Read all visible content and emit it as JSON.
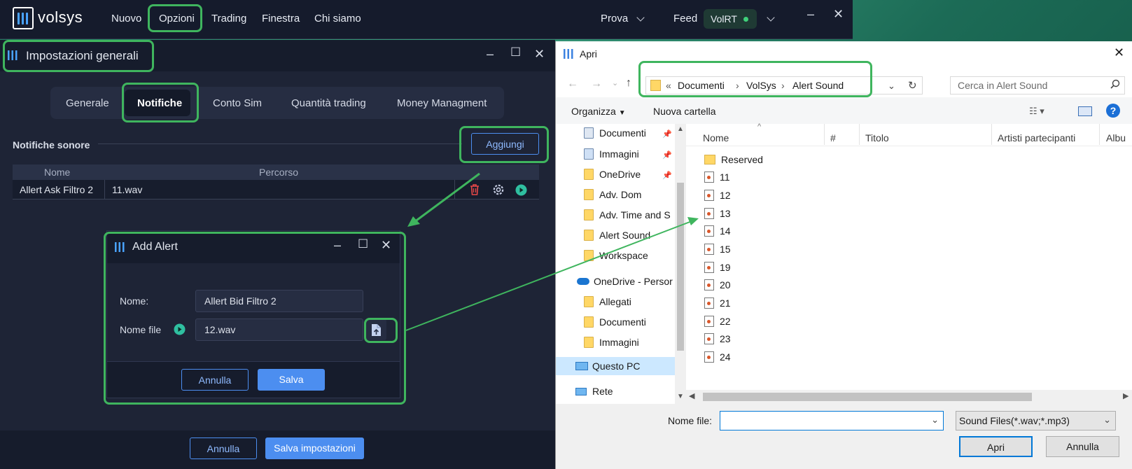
{
  "app": {
    "logo": "volsys",
    "menu": [
      "Nuovo",
      "Opzioni",
      "Trading",
      "Finestra",
      "Chi siamo"
    ],
    "right": {
      "prova": "Prova",
      "feed": "Feed",
      "feed_badge": "VolRT"
    }
  },
  "settings": {
    "title": "Impostazioni generali",
    "tabs": [
      "Generale",
      "Notifiche",
      "Conto Sim",
      "Quantità trading",
      "Money Managment"
    ],
    "active_tab": "Notifiche",
    "section_title": "Notifiche sonore",
    "add_button": "Aggiungi",
    "table": {
      "headers": [
        "Nome",
        "Percorso"
      ],
      "rows": [
        {
          "name": "Allert Ask Filtro 2",
          "path": "11.wav"
        }
      ]
    },
    "footer": {
      "cancel": "Annulla",
      "save": "Salva impostazioni"
    }
  },
  "add_alert": {
    "title": "Add Alert",
    "name_label": "Nome:",
    "name_value": "Allert Bid Filtro 2",
    "file_label": "Nome file",
    "file_value": "12.wav",
    "cancel": "Annulla",
    "save": "Salva"
  },
  "file_dialog": {
    "title": "Apri",
    "breadcrumb_prefix": "«",
    "breadcrumb": [
      "Documenti",
      "VolSys",
      "Alert Sound"
    ],
    "search_placeholder": "Cerca in Alert Sound",
    "toolbar": {
      "organize": "Organizza",
      "new_folder": "Nuova cartella"
    },
    "tree": {
      "quick_access": [
        "Documenti",
        "Immagini",
        "OneDrive",
        "Adv. Dom",
        "Adv. Time and S",
        "Alert Sound",
        "Workspace"
      ],
      "onedrive": "OneDrive - Persor",
      "onedrive_items": [
        "Allegati",
        "Documenti",
        "Immagini"
      ],
      "this_pc": "Questo PC",
      "network": "Rete"
    },
    "columns": [
      "Nome",
      "#",
      "Titolo",
      "Artisti partecipanti",
      "Albu"
    ],
    "folders": [
      "Reserved"
    ],
    "files": [
      "11",
      "12",
      "13",
      "14",
      "15",
      "19",
      "20",
      "21",
      "22",
      "23",
      "24"
    ],
    "filename_label": "Nome file:",
    "filename_value": "",
    "filter": "Sound Files(*.wav;*.mp3)",
    "open": "Apri",
    "cancel": "Annulla"
  },
  "colors": {
    "highlight": "#3fb55e",
    "accent": "#4c8ef0",
    "app_bg": "#1e2436"
  }
}
